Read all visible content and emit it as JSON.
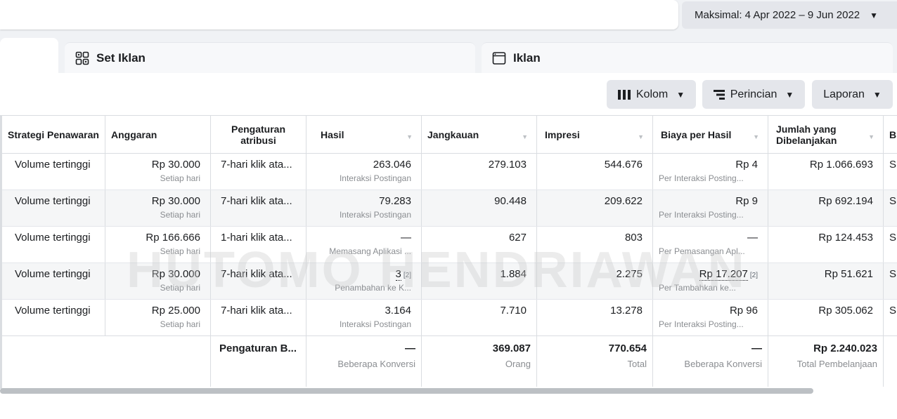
{
  "top": {
    "date_range": "Maksimal: 4 Apr 2022 – 9 Jun 2022"
  },
  "tabs": {
    "adset": "Set Iklan",
    "ad": "Iklan"
  },
  "toolbar": {
    "kolom": "Kolom",
    "perincian": "Perincian",
    "laporan": "Laporan"
  },
  "watermark": "HUTOMO HENDRIAWAN",
  "table": {
    "headers": {
      "strategy": "Strategi Penawaran",
      "budget": "Anggaran",
      "attribution": "Pengaturan atribusi",
      "results": "Hasil",
      "reach": "Jangkauan",
      "impressions": "Impresi",
      "cost_per_result": "Biaya per Hasil",
      "amount_spent": "Jumlah yang Dibelanjakan",
      "next": "B"
    },
    "rows": [
      {
        "strategy": "Volume tertinggi",
        "budget": "Rp 30.000",
        "budget_sub": "Setiap hari",
        "attribution": "7-hari klik ata...",
        "results": "263.046",
        "results_sub": "Interaksi Postingan",
        "reach": "279.103",
        "impressions": "544.676",
        "cpr": "Rp 4",
        "cpr_sub": "Per Interaksi Posting...",
        "spent": "Rp 1.066.693",
        "next": "S"
      },
      {
        "strategy": "Volume tertinggi",
        "budget": "Rp 30.000",
        "budget_sub": "Setiap hari",
        "attribution": "7-hari klik ata...",
        "results": "79.283",
        "results_sub": "Interaksi Postingan",
        "reach": "90.448",
        "impressions": "209.622",
        "cpr": "Rp 9",
        "cpr_sub": "Per Interaksi Posting...",
        "spent": "Rp 692.194",
        "next": "S"
      },
      {
        "strategy": "Volume tertinggi",
        "budget": "Rp 166.666",
        "budget_sub": "Setiap hari",
        "attribution": "1-hari klik ata...",
        "results": "—",
        "results_sub": "Memasang Aplikasi ...",
        "reach": "627",
        "impressions": "803",
        "cpr": "—",
        "cpr_sub": "Per Pemasangan Apl...",
        "spent": "Rp 124.453",
        "next": "S"
      },
      {
        "strategy": "Volume tertinggi",
        "budget": "Rp 30.000",
        "budget_sub": "Setiap hari",
        "attribution": "7-hari klik ata...",
        "results": "3",
        "results_note": "[2]",
        "results_sub": "Penambahan ke K...",
        "reach": "1.884",
        "impressions": "2.275",
        "cpr": "Rp 17.207",
        "cpr_note": "[2]",
        "cpr_sub": "Per Tambahkan ke...",
        "spent": "Rp 51.621",
        "next": "S"
      },
      {
        "strategy": "Volume tertinggi",
        "budget": "Rp 25.000",
        "budget_sub": "Setiap hari",
        "attribution": "7-hari klik ata...",
        "results": "3.164",
        "results_sub": "Interaksi Postingan",
        "reach": "7.710",
        "impressions": "13.278",
        "cpr": "Rp 96",
        "cpr_sub": "Per Interaksi Posting...",
        "spent": "Rp 305.062",
        "next": "S"
      }
    ],
    "totals": {
      "attribution": "Pengaturan B...",
      "results": "—",
      "results_sub": "Beberapa Konversi",
      "reach": "369.087",
      "reach_sub": "Orang",
      "impressions": "770.654",
      "impressions_sub": "Total",
      "cpr": "—",
      "cpr_sub": "Beberapa Konversi",
      "spent": "Rp 2.240.023",
      "spent_sub": "Total Pembelanjaan"
    }
  }
}
